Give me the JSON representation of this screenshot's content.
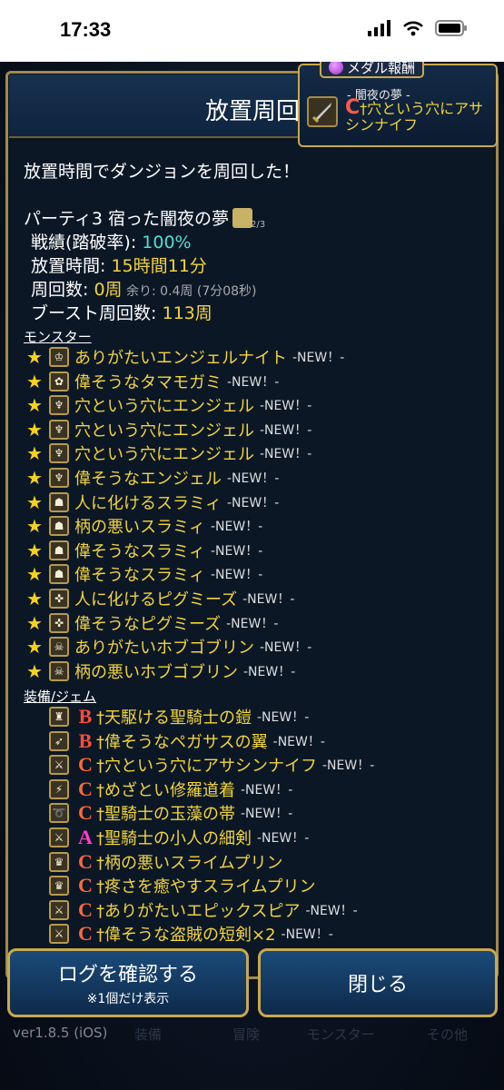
{
  "status_bar": {
    "time": "17:33"
  },
  "header": {
    "title": "放置周回"
  },
  "medal_reward": {
    "tab_label": "メダル報酬",
    "subtitle": "- 闇夜の夢 -",
    "rank": "C",
    "item_name": "†穴という穴にアサシンナイフ"
  },
  "summary": {
    "intro": "放置時間でダンジョンを周回した！",
    "party": "パーティ3 宿った闇夜の夢",
    "party_fraction": "2/3",
    "record_label": "戦績(踏破率): ",
    "record_value": "100%",
    "idle_label": "放置時間: ",
    "idle_value": "15時間11分",
    "laps_label": "周回数: ",
    "laps_value": "0周",
    "laps_remainder": " 余り: 0.4周 (7分08秒)",
    "boost_label": "ブースト周回数: ",
    "boost_value": "113周"
  },
  "monsters": {
    "heading": "モンスター",
    "items": [
      {
        "name": "ありがたいエンジェルナイト",
        "tag": "-NEW！-"
      },
      {
        "name": "偉そうなタマモガミ",
        "tag": "-NEW！-"
      },
      {
        "name": "穴という穴にエンジェル",
        "tag": "-NEW！-"
      },
      {
        "name": "穴という穴にエンジェル",
        "tag": "-NEW！-"
      },
      {
        "name": "穴という穴にエンジェル",
        "tag": "-NEW！-"
      },
      {
        "name": "偉そうなエンジェル",
        "tag": "-NEW！-"
      },
      {
        "name": "人に化けるスラミィ",
        "tag": "-NEW！-"
      },
      {
        "name": "柄の悪いスラミィ",
        "tag": "-NEW！-"
      },
      {
        "name": "偉そうなスラミィ",
        "tag": "-NEW！-"
      },
      {
        "name": "偉そうなスラミィ",
        "tag": "-NEW！-"
      },
      {
        "name": "人に化けるピグミーズ",
        "tag": "-NEW！-"
      },
      {
        "name": "偉そうなピグミーズ",
        "tag": "-NEW！-"
      },
      {
        "name": "ありがたいホブゴブリン",
        "tag": "-NEW！-"
      },
      {
        "name": "柄の悪いホブゴブリン",
        "tag": "-NEW！-"
      }
    ]
  },
  "equipment": {
    "heading": "装備/ジェム",
    "items": [
      {
        "rank": "B",
        "name": "†天駆ける聖騎士の鎧",
        "tag": "-NEW！-"
      },
      {
        "rank": "B",
        "name": "†偉そうなペガサスの翼",
        "tag": "-NEW！-"
      },
      {
        "rank": "C",
        "name": "†穴という穴にアサシンナイフ",
        "tag": "-NEW！-"
      },
      {
        "rank": "C",
        "name": "†めざとい修羅道着",
        "tag": "-NEW！-"
      },
      {
        "rank": "C",
        "name": "†聖騎士の玉藻の帯",
        "tag": "-NEW！-"
      },
      {
        "rank": "A",
        "name": "†聖騎士の小人の細剣",
        "tag": "-NEW！-"
      },
      {
        "rank": "C",
        "name": "†柄の悪いスライムプリン",
        "tag": ""
      },
      {
        "rank": "C",
        "name": "†疼さを癒やすスライムプリン",
        "tag": ""
      },
      {
        "rank": "C",
        "name": "†ありがたいエピックスピア",
        "tag": "-NEW！-"
      },
      {
        "rank": "C",
        "name": "†偉そうな盗賊の短剣×2",
        "tag": "-NEW！-"
      }
    ]
  },
  "buttons": {
    "log_label": "ログを確認する",
    "log_note": "※1個だけ表示",
    "close_label": "閉じる"
  },
  "footer": {
    "version": "ver1.8.5 (iOS)",
    "ghost_tabs": [
      "装備",
      "冒険",
      "モンスター",
      "その他"
    ]
  },
  "colors": {
    "accent_gold": "#c9a94e",
    "name_yellow": "#f1d53b",
    "value_cyan": "#4ee0d0",
    "rank_b": "#ff4d3a",
    "rank_c": "#ff6a3a",
    "rank_a": "#ff3ec9"
  }
}
